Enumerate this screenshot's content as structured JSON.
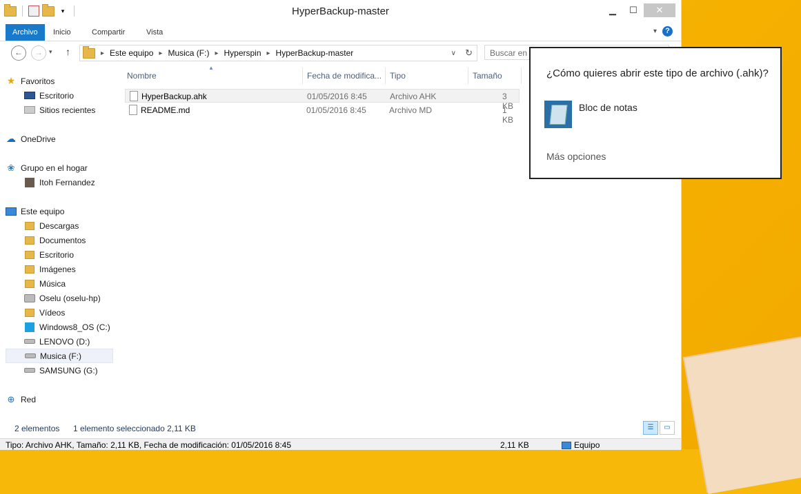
{
  "window": {
    "title": "HyperBackup-master"
  },
  "ribbon": {
    "tabs": [
      "Archivo",
      "Inicio",
      "Compartir",
      "Vista"
    ]
  },
  "address": {
    "segments": [
      "Este equipo",
      "Musica (F:)",
      "Hyperspin",
      "HyperBackup-master"
    ],
    "search_placeholder": "Buscar en H"
  },
  "sidebar": {
    "favorites": [
      "Favoritos",
      "Escritorio",
      "Sitios recientes"
    ],
    "onedrive": "OneDrive",
    "homegroup": [
      "Grupo en el hogar",
      "Itoh Fernandez"
    ],
    "pc": [
      "Este equipo",
      "Descargas",
      "Documentos",
      "Escritorio",
      "Imágenes",
      "Música",
      "Oselu (oselu-hp)",
      "Vídeos",
      "Windows8_OS (C:)",
      "LENOVO (D:)",
      "Musica (F:)",
      "SAMSUNG (G:)"
    ],
    "network": "Red"
  },
  "columns": [
    "Nombre",
    "Fecha de modifica...",
    "Tipo",
    "Tamaño"
  ],
  "files": [
    {
      "name": "HyperBackup.ahk",
      "date": "01/05/2016 8:45",
      "type": "Archivo AHK",
      "size": "3 KB"
    },
    {
      "name": "README.md",
      "date": "01/05/2016 8:45",
      "type": "Archivo MD",
      "size": "1 KB"
    }
  ],
  "status": {
    "count": "2 elementos",
    "selection": "1 elemento seleccionado  2,11 KB"
  },
  "footer": {
    "details": "Tipo: Archivo AHK, Tamaño: 2,11 KB, Fecha de modificación: 01/05/2016 8:45",
    "size": "2,11 KB",
    "location": "Equipo"
  },
  "popup": {
    "question": "¿Cómo quieres abrir este tipo de archivo (.ahk)?",
    "app": "Bloc de notas",
    "more": "Más opciones"
  }
}
